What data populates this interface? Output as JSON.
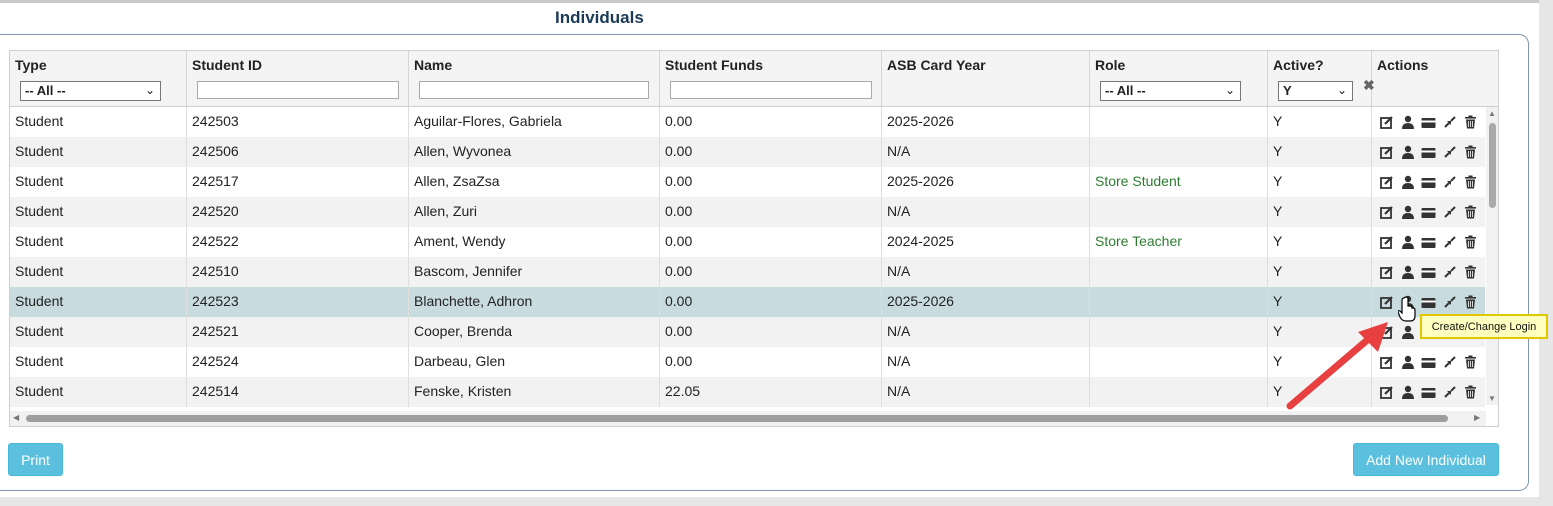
{
  "page_title": "Individuals",
  "columns": {
    "type": "Type",
    "student_id": "Student ID",
    "name": "Name",
    "student_funds": "Student Funds",
    "asb_card_year": "ASB Card Year",
    "role": "Role",
    "active": "Active?",
    "actions": "Actions"
  },
  "filters": {
    "type_selected": "-- All --",
    "student_id_value": "",
    "name_value": "",
    "funds_value": "",
    "role_selected": "-- All --",
    "active_selected": "Y",
    "clear_icon": "close-icon"
  },
  "rows": [
    {
      "type": "Student",
      "id": "242503",
      "name": "Aguilar-Flores, Gabriela",
      "funds": "0.00",
      "asb": "2025-2026",
      "role": "",
      "active": "Y"
    },
    {
      "type": "Student",
      "id": "242506",
      "name": "Allen, Wyvonea",
      "funds": "0.00",
      "asb": "N/A",
      "role": "",
      "active": "Y"
    },
    {
      "type": "Student",
      "id": "242517",
      "name": "Allen, ZsaZsa",
      "funds": "0.00",
      "asb": "2025-2026",
      "role": "Store Student",
      "active": "Y"
    },
    {
      "type": "Student",
      "id": "242520",
      "name": "Allen, Zuri",
      "funds": "0.00",
      "asb": "N/A",
      "role": "",
      "active": "Y"
    },
    {
      "type": "Student",
      "id": "242522",
      "name": "Ament, Wendy",
      "funds": "0.00",
      "asb": "2024-2025",
      "role": "Store Teacher",
      "active": "Y"
    },
    {
      "type": "Student",
      "id": "242510",
      "name": "Bascom, Jennifer",
      "funds": "0.00",
      "asb": "N/A",
      "role": "",
      "active": "Y"
    },
    {
      "type": "Student",
      "id": "242523",
      "name": "Blanchette, Adhron",
      "funds": "0.00",
      "asb": "2025-2026",
      "role": "",
      "active": "Y"
    },
    {
      "type": "Student",
      "id": "242521",
      "name": "Cooper, Brenda",
      "funds": "0.00",
      "asb": "N/A",
      "role": "",
      "active": "Y"
    },
    {
      "type": "Student",
      "id": "242524",
      "name": "Darbeau, Glen",
      "funds": "0.00",
      "asb": "N/A",
      "role": "",
      "active": "Y"
    },
    {
      "type": "Student",
      "id": "242514",
      "name": "Fenske, Kristen",
      "funds": "22.05",
      "asb": "N/A",
      "role": "",
      "active": "Y"
    }
  ],
  "action_icons": [
    "edit-icon",
    "user-icon",
    "card-icon",
    "merge-icon",
    "trash-icon"
  ],
  "buttons": {
    "print": "Print",
    "add_new": "Add New Individual"
  },
  "tooltip": "Create/Change Login",
  "colors": {
    "accent_button": "#5bc0de",
    "selected_row": "#c8dcdf",
    "role_text": "#2e7d32",
    "annotation_arrow": "#e84040",
    "tooltip_bg": "#ffffc0"
  }
}
